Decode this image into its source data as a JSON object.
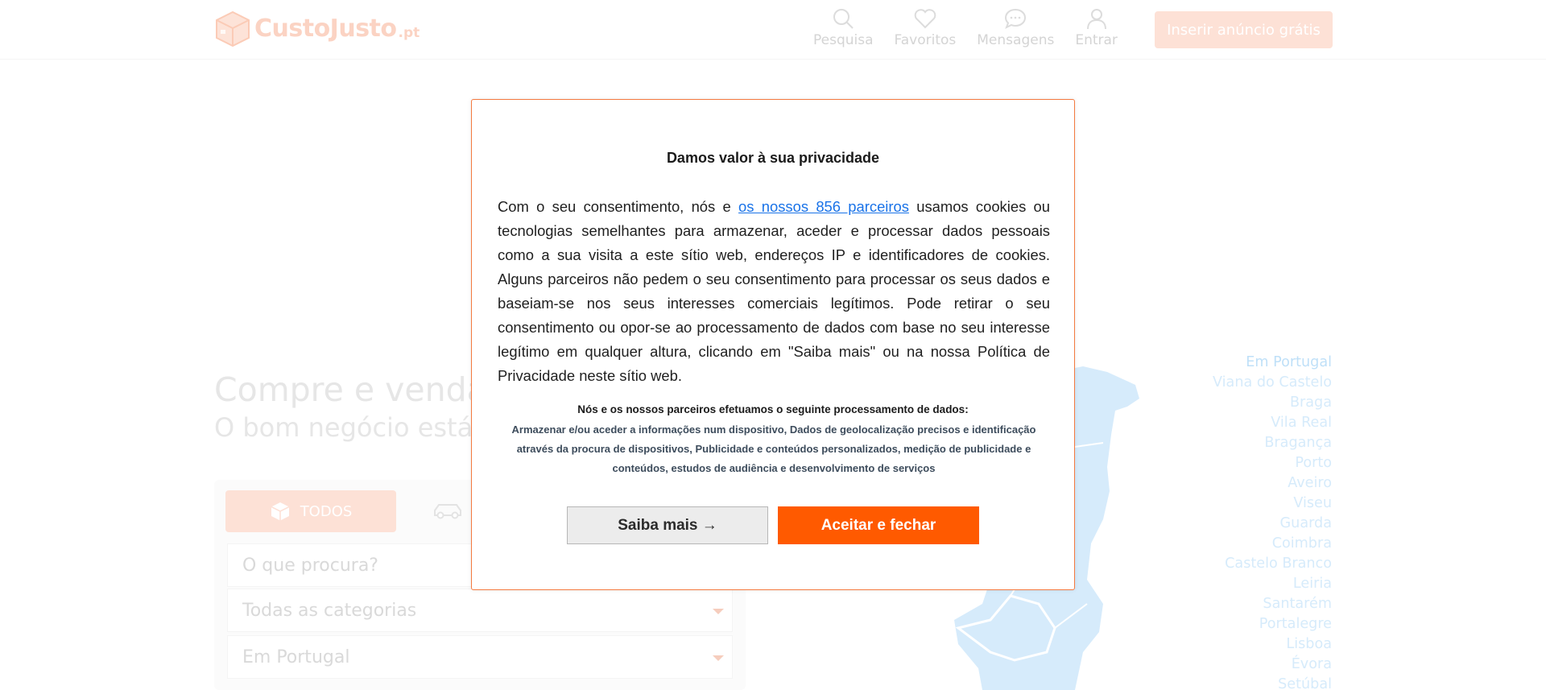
{
  "header": {
    "logo_text": "CustoJusto",
    "logo_tld": ".pt",
    "nav": [
      {
        "label": "Pesquisa",
        "icon": "search-icon"
      },
      {
        "label": "Favoritos",
        "icon": "heart-icon"
      },
      {
        "label": "Mensagens",
        "icon": "chat-icon"
      },
      {
        "label": "Entrar",
        "icon": "user-icon"
      }
    ],
    "insert_button": "Inserir anúncio grátis"
  },
  "hero": {
    "title": "Compre e venda",
    "subtitle": "O bom negócio está a"
  },
  "search": {
    "tab_all": "TODOS",
    "query_placeholder": "O que procura?",
    "category_value": "Todas as categorias",
    "location_value": "Em Portugal"
  },
  "regions": [
    "Em Portugal",
    "Viana do Castelo",
    "Braga",
    "Vila Real",
    "Bragança",
    "Porto",
    "Aveiro",
    "Viseu",
    "Guarda",
    "Coimbra",
    "Castelo Branco",
    "Leiria",
    "Santarém",
    "Portalegre",
    "Lisboa",
    "Évora",
    "Setúbal"
  ],
  "consent": {
    "title": "Damos valor à sua privacidade",
    "body_before_link": "Com o seu consentimento, nós e ",
    "partners_link": "os nossos 856 parceiros",
    "body_after_link": " usamos cookies ou tecnologias semelhantes para armazenar, aceder e processar dados pessoais como a sua visita a este sítio web, endereços IP e identificadores de cookies. Alguns parceiros não pedem o seu consentimento para processar os seus dados e baseiam-se nos seus interesses comerciais legítimos. Pode retirar o seu consentimento ou opor-se ao processamento de dados com base no seu interesse legítimo em qualquer altura, clicando em \"Saiba mais\" ou na nossa Política de Privacidade neste sítio web.",
    "processing_title": "Nós e os nossos parceiros efetuamos o seguinte processamento de dados:",
    "processing_list": "Armazenar e/ou aceder a informações num dispositivo, Dados de geolocalização precisos e identificação através da procura de dispositivos, Publicidade e conteúdos personalizados, medição de publicidade e conteúdos, estudos de audiência e desenvolvimento de serviços",
    "more_button": "Saiba mais →",
    "accept_button": "Aceitar e fechar"
  },
  "colors": {
    "accent": "#ff5a00",
    "modal_border": "#f47a40",
    "link": "#1a73e8"
  }
}
